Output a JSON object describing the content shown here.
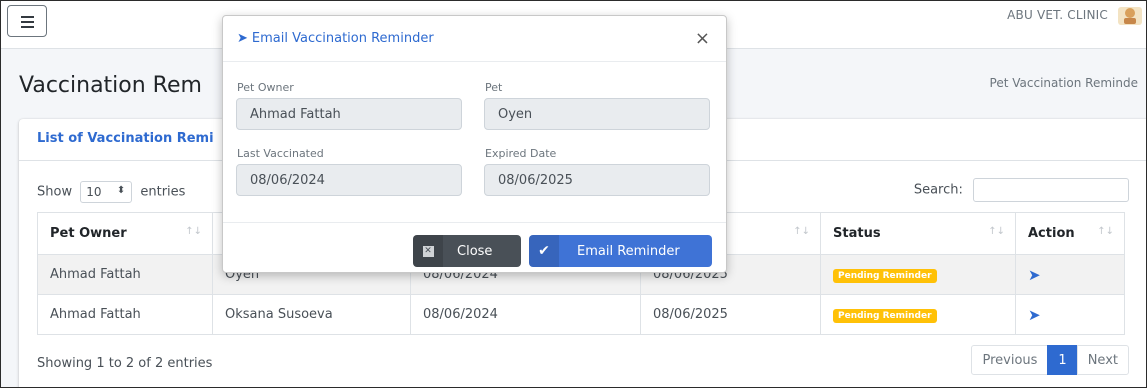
{
  "navbar": {
    "brand": "ABU VET. CLINIC"
  },
  "header": {
    "title": "Vaccination Rem",
    "breadcrumb": "Pet Vaccination Reminde"
  },
  "card": {
    "title": "List of Vaccination Remi",
    "show_label": "Show",
    "entries_value": "10",
    "entries_label": "entries",
    "search_label": "Search:",
    "info": "Showing 1 to 2 of 2 entries"
  },
  "table": {
    "columns": [
      "Pet Owner",
      "",
      "",
      "te",
      "Status",
      "Action"
    ],
    "rows": [
      {
        "owner": "Ahmad Fattah",
        "pet": "Oyen",
        "last": "08/06/2024",
        "expired": "08/06/2025",
        "status": "Pending Reminder"
      },
      {
        "owner": "Ahmad Fattah",
        "pet": "Oksana Susoeva",
        "last": "08/06/2024",
        "expired": "08/06/2025",
        "status": "Pending Reminder"
      }
    ]
  },
  "pagination": {
    "prev": "Previous",
    "page": "1",
    "next": "Next"
  },
  "modal": {
    "title": "Email Vaccination Reminder",
    "close_symbol": "×",
    "owner_label": "Pet Owner",
    "owner_value": "Ahmad Fattah",
    "pet_label": "Pet",
    "pet_value": "Oyen",
    "last_label": "Last Vaccinated",
    "last_value": "08/06/2024",
    "expired_label": "Expired Date",
    "expired_value": "08/06/2025",
    "close_button": "Close",
    "email_button": "Email Reminder"
  },
  "colors": {
    "primary": "#2e6ad0",
    "warning": "#ffc107",
    "secondary": "#495057"
  }
}
